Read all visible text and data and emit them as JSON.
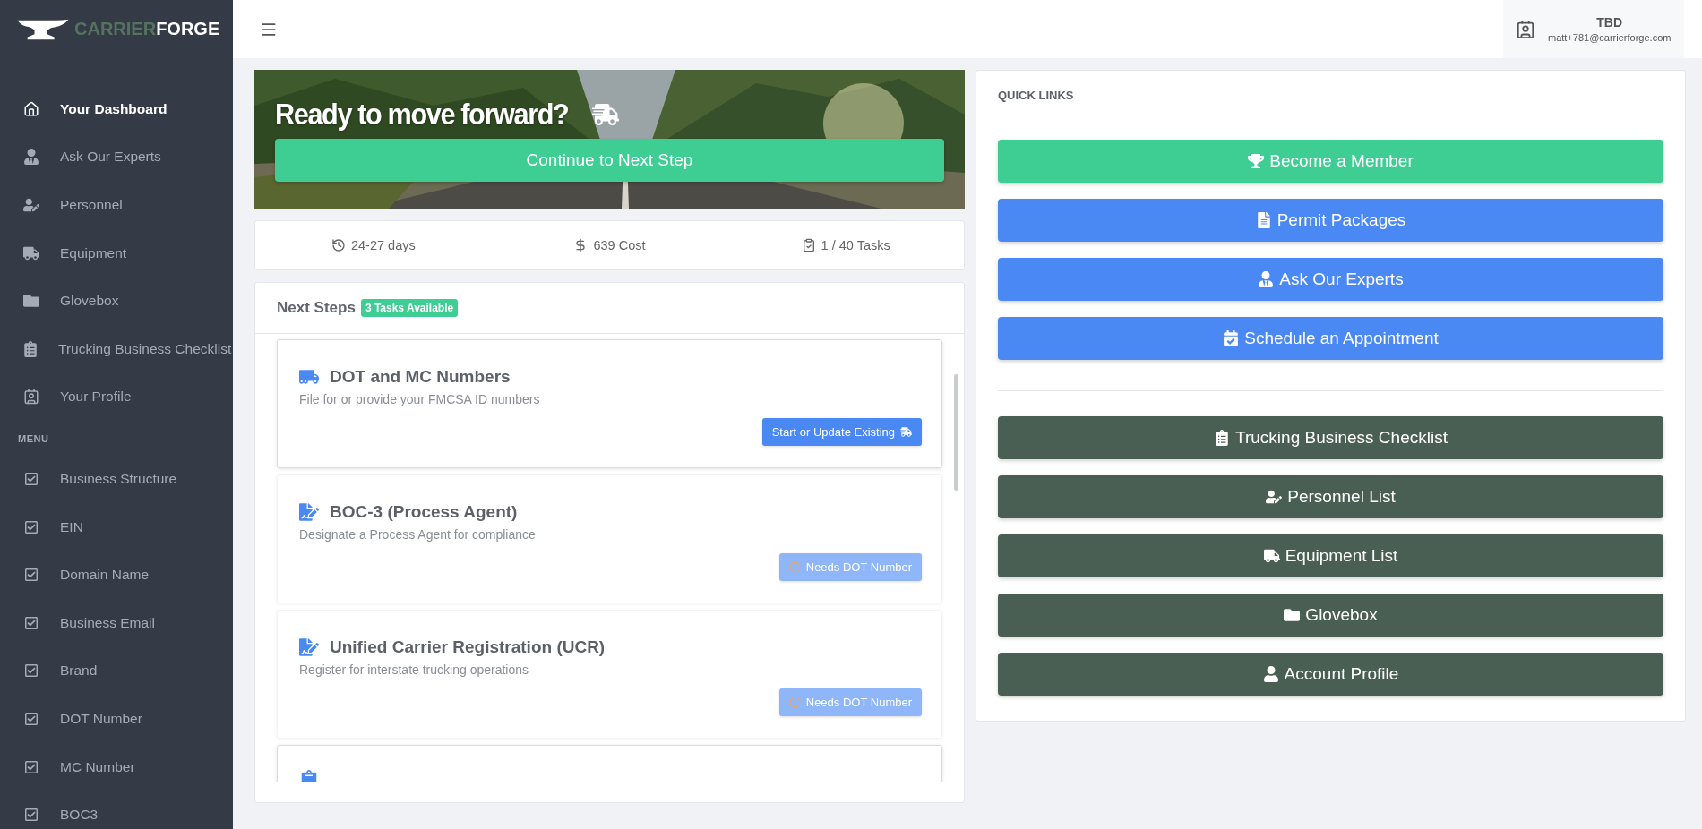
{
  "logo": {
    "parts": [
      "CARRIER",
      "FORGE"
    ]
  },
  "sidebar": {
    "items": [
      {
        "label": "Your Dashboard",
        "selected": true
      },
      {
        "label": "Ask Our Experts",
        "selected": false
      },
      {
        "label": "Personnel",
        "selected": false
      },
      {
        "label": "Equipment",
        "selected": false
      },
      {
        "label": "Glovebox",
        "selected": false
      },
      {
        "label": "Trucking Business Checklist",
        "selected": false
      },
      {
        "label": "Your Profile",
        "selected": false
      }
    ],
    "section_label": "MENU",
    "menu_items": [
      {
        "label": "Business Structure",
        "checked": true
      },
      {
        "label": "EIN",
        "checked": true
      },
      {
        "label": "Domain Name",
        "checked": true
      },
      {
        "label": "Business Email",
        "checked": true
      },
      {
        "label": "Brand",
        "checked": true
      },
      {
        "label": "DOT Number",
        "checked": true
      },
      {
        "label": "MC Number",
        "checked": true
      },
      {
        "label": "BOC3",
        "checked": true
      }
    ]
  },
  "user": {
    "name": "TBD",
    "email": "matt+781@carrierforge.com"
  },
  "banner": {
    "kind": "picture",
    "title": "Ready to move forward?",
    "button": "Continue to Next Step"
  },
  "stats": [
    {
      "text": "24-27 days"
    },
    {
      "text": "639 Cost"
    },
    {
      "text": "1 / 40 Tasks"
    }
  ],
  "next_steps": {
    "title": "Next Steps",
    "badge": "3 Tasks Available",
    "tasks": [
      {
        "title": "DOT and MC Numbers",
        "description": "File for or provide your FMCSA ID numbers",
        "button": "Start or Update Existing",
        "disabled": false,
        "selected": true
      },
      {
        "title": "BOC-3 (Process Agent)",
        "description": "Designate a Process Agent for compliance",
        "button": "Needs DOT Number",
        "disabled": true,
        "selected": false
      },
      {
        "title": "Unified Carrier Registration (UCR)",
        "description": "Register for interstate trucking operations",
        "button": "Needs DOT Number",
        "disabled": true,
        "selected": false
      }
    ]
  },
  "quick_links": {
    "title": "QUICK LINKS",
    "groups": [
      [
        {
          "label": "Become a Member",
          "color": "#3ecd93"
        },
        {
          "label": "Permit Packages",
          "color": "#4a89f3"
        },
        {
          "label": "Ask Our Experts",
          "color": "#4a89f3"
        },
        {
          "label": "Schedule an Appointment",
          "color": "#4a89f3"
        }
      ],
      [
        {
          "label": "Trucking Business Checklist",
          "color": "#4a5f53"
        },
        {
          "label": "Personnel List",
          "color": "#4a5f53"
        },
        {
          "label": "Equipment List",
          "color": "#4a5f53"
        },
        {
          "label": "Glovebox",
          "color": "#4a5f53"
        },
        {
          "label": "Account Profile",
          "color": "#4a5f53"
        }
      ]
    ]
  }
}
